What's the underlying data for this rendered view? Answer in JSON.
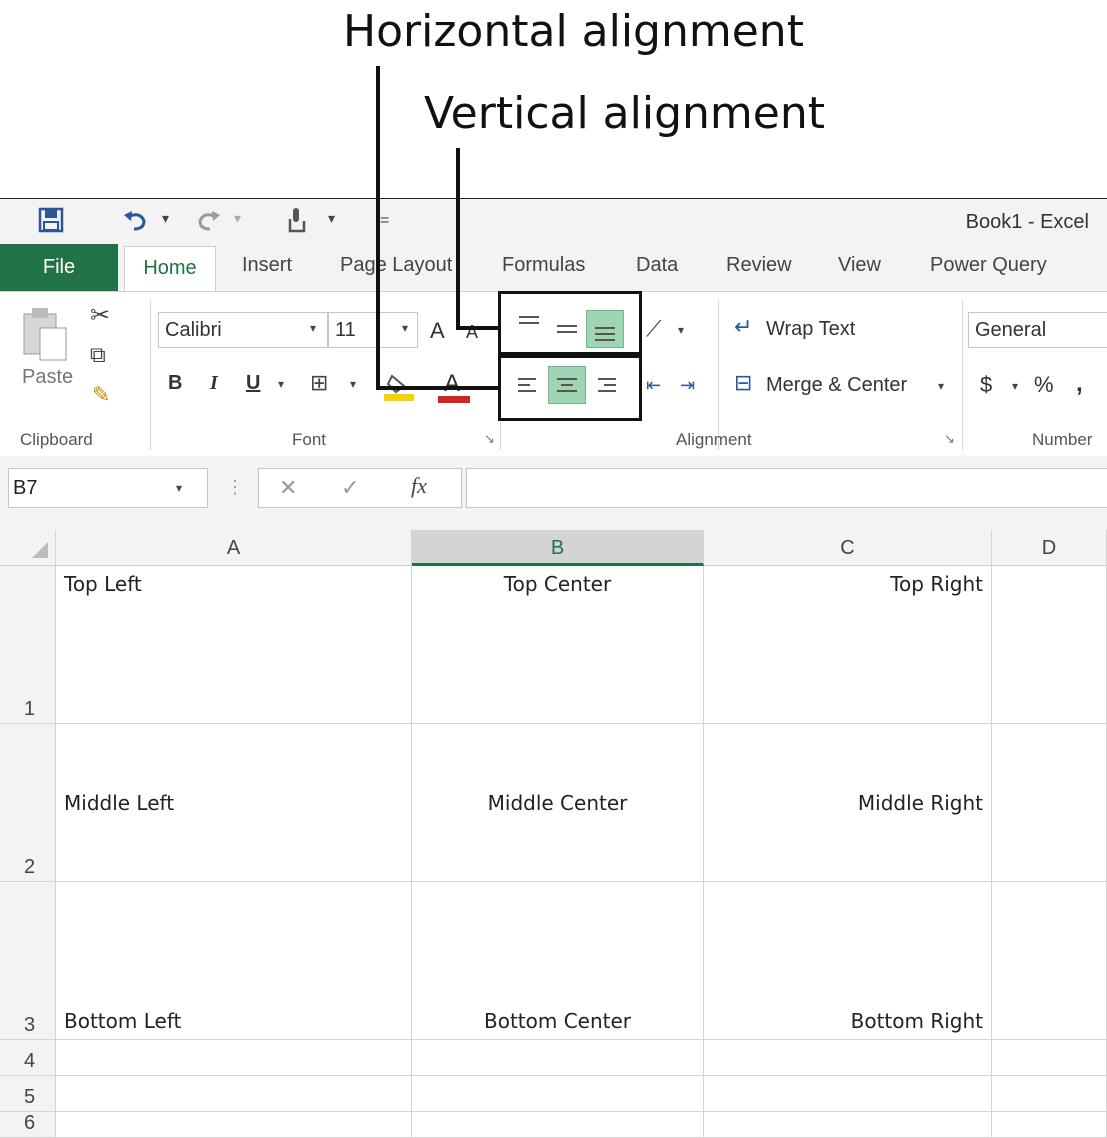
{
  "annotations": {
    "horizontal": "Horizontal alignment",
    "vertical": "Vertical alignment"
  },
  "window": {
    "title": "Book1 - Excel"
  },
  "quick_access": {
    "icons": [
      "save-icon",
      "undo-icon",
      "redo-icon",
      "touch-mode-icon",
      "customize-icon"
    ]
  },
  "tabs": [
    "File",
    "Home",
    "Insert",
    "Page Layout",
    "Formulas",
    "Data",
    "Review",
    "View",
    "Power Query"
  ],
  "ribbon": {
    "clipboard": {
      "paste": "Paste",
      "label": "Clipboard"
    },
    "font": {
      "name": "Calibri",
      "size": "11",
      "bold": "B",
      "italic": "I",
      "underline": "U",
      "grow": "A",
      "shrink": "A",
      "color": "A",
      "label": "Font"
    },
    "alignment": {
      "wrap": "Wrap Text",
      "merge": "Merge & Center",
      "label": "Alignment",
      "active_vertical": "bottom",
      "active_horizontal": "center"
    },
    "number": {
      "format": "General",
      "currency": "$",
      "percent": "%",
      "comma": ",",
      "label": "Number"
    }
  },
  "formula_bar": {
    "name_box": "B7",
    "cancel": "✕",
    "enter": "✓",
    "fx": "fx",
    "value": ""
  },
  "columns": [
    "A",
    "B",
    "C",
    "D"
  ],
  "selected_column": "B",
  "rows": [
    {
      "num": "1",
      "cells": [
        "Top Left",
        "Top Center",
        "Top Right",
        ""
      ]
    },
    {
      "num": "2",
      "cells": [
        "Middle Left",
        "Middle Center",
        "Middle Right",
        ""
      ]
    },
    {
      "num": "3",
      "cells": [
        "Bottom Left",
        "Bottom Center",
        "Bottom Right",
        ""
      ]
    },
    {
      "num": "4",
      "cells": [
        "",
        "",
        "",
        ""
      ]
    },
    {
      "num": "5",
      "cells": [
        "",
        "",
        "",
        ""
      ]
    },
    {
      "num": "6",
      "cells": [
        "",
        "",
        "",
        ""
      ]
    }
  ],
  "colors": {
    "accent": "#217346",
    "highlight_fill": "#9fd5b3",
    "fill_color": "#f2d200",
    "font_color": "#d32424"
  }
}
